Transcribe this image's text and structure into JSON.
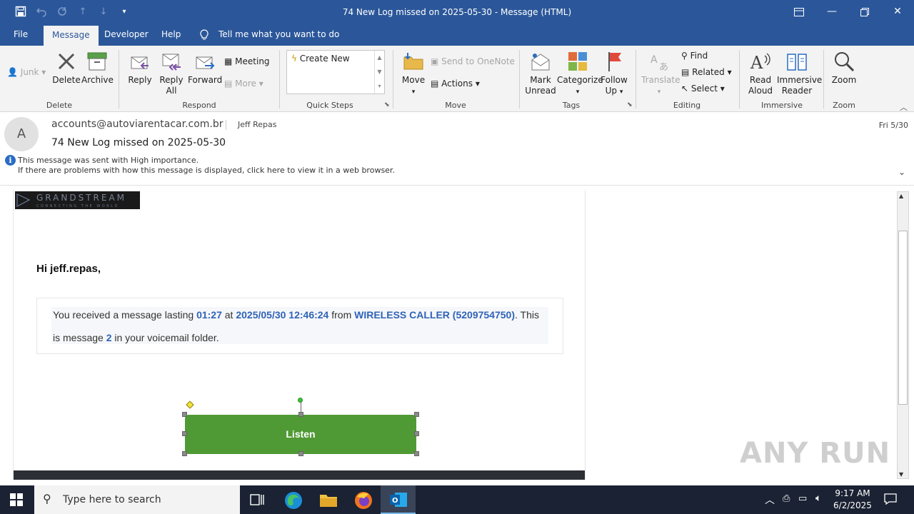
{
  "window": {
    "title": "74 New Log missed on 2025-05-30  -  Message (HTML)"
  },
  "menu": {
    "file": "File",
    "message": "Message",
    "developer": "Developer",
    "help": "Help",
    "tell_me": "Tell me what you want to do"
  },
  "ribbon": {
    "junk": "Junk",
    "delete": "Delete",
    "archive": "Archive",
    "group_delete": "Delete",
    "reply": "Reply",
    "reply_all_1": "Reply",
    "reply_all_2": "All",
    "forward": "Forward",
    "meeting": "Meeting",
    "more": "More",
    "group_respond": "Respond",
    "quick_step_create": "Create New",
    "group_quick_steps": "Quick Steps",
    "move": "Move",
    "send_onenote": "Send to OneNote",
    "actions": "Actions",
    "group_move": "Move",
    "mark_unread_1": "Mark",
    "mark_unread_2": "Unread",
    "categorize": "Categorize",
    "follow_up_1": "Follow",
    "follow_up_2": "Up",
    "group_tags": "Tags",
    "translate": "Translate",
    "find": "Find",
    "related": "Related",
    "select": "Select",
    "group_editing": "Editing",
    "read_aloud_1": "Read",
    "read_aloud_2": "Aloud",
    "immersive_1": "Immersive",
    "immersive_2": "Reader",
    "group_immersive": "Immersive",
    "zoom": "Zoom",
    "group_zoom": "Zoom"
  },
  "header": {
    "avatar_initial": "A",
    "from": "accounts@autoviarentacar.com.br",
    "to": "Jeff Repas",
    "subject": "74 New Log missed on 2025-05-30",
    "date": "Fri 5/30",
    "importance": "This message was sent with High importance.",
    "display_note": "If there are problems with how this message is displayed, click here to view it in a web browser."
  },
  "email": {
    "logo_text": "GRANDSTREAM",
    "logo_tagline": "CONNECTING THE WORLD",
    "greeting": "Hi jeff.repas,",
    "msg_part1": "You received a message lasting ",
    "duration": "01:27",
    "msg_part2": " at ",
    "timestamp": "2025/05/30 12:46:24",
    "msg_part3": " from ",
    "caller": "WIRELESS CALLER (5209754750)",
    "msg_part4": ". This",
    "msg_part5": "is message ",
    "msg_number": "2",
    "msg_part6": " in your voicemail folder.",
    "listen_button": "Listen"
  },
  "watermark": "ANY RUN",
  "taskbar": {
    "search_placeholder": "Type here to search",
    "time": "9:17 AM",
    "date": "6/2/2025"
  },
  "colors": {
    "accent": "#2b579a",
    "listen_green": "#4f9a34",
    "link_blue": "#2f63b7"
  }
}
